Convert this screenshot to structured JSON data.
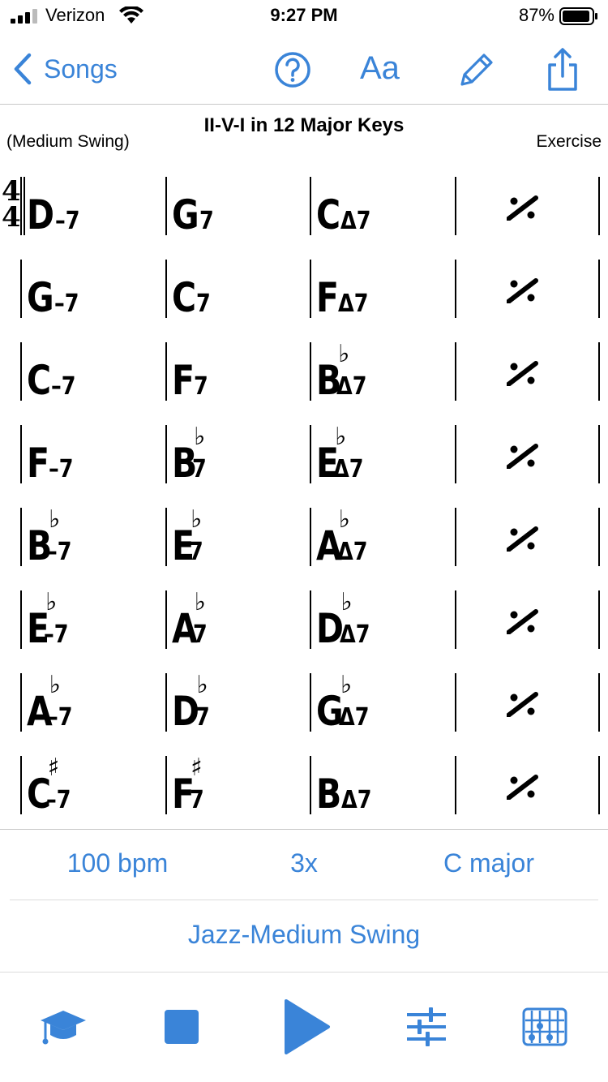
{
  "status_bar": {
    "carrier": "Verizon",
    "time": "9:27 PM",
    "battery_percent": "87%"
  },
  "nav": {
    "back_label": "Songs",
    "font_button_label": "Aa",
    "icons": [
      "help-icon",
      "font-size-icon",
      "edit-pencil-icon",
      "share-icon"
    ]
  },
  "song": {
    "title": "II-V-I in 12 Major Keys",
    "style": "(Medium Swing)",
    "composer": "Exercise",
    "time_signature": {
      "top": "4",
      "bottom": "4"
    }
  },
  "chart": {
    "rows": [
      [
        {
          "root": "D",
          "acc": "",
          "qual": "–7"
        },
        {
          "root": "G",
          "acc": "",
          "qual": "7"
        },
        {
          "root": "C",
          "acc": "",
          "qual": "Δ7"
        },
        {
          "repeat": true
        }
      ],
      [
        {
          "root": "G",
          "acc": "",
          "qual": "–7"
        },
        {
          "root": "C",
          "acc": "",
          "qual": "7"
        },
        {
          "root": "F",
          "acc": "",
          "qual": "Δ7"
        },
        {
          "repeat": true
        }
      ],
      [
        {
          "root": "C",
          "acc": "",
          "qual": "–7"
        },
        {
          "root": "F",
          "acc": "",
          "qual": "7"
        },
        {
          "root": "B",
          "acc": "♭",
          "qual": "Δ7"
        },
        {
          "repeat": true
        }
      ],
      [
        {
          "root": "F",
          "acc": "",
          "qual": "–7"
        },
        {
          "root": "B",
          "acc": "♭",
          "qual": "7"
        },
        {
          "root": "E",
          "acc": "♭",
          "qual": "Δ7"
        },
        {
          "repeat": true
        }
      ],
      [
        {
          "root": "B",
          "acc": "♭",
          "qual": "–7"
        },
        {
          "root": "E",
          "acc": "♭",
          "qual": "7"
        },
        {
          "root": "A",
          "acc": "♭",
          "qual": "Δ7"
        },
        {
          "repeat": true
        }
      ],
      [
        {
          "root": "E",
          "acc": "♭",
          "qual": "–7"
        },
        {
          "root": "A",
          "acc": "♭",
          "qual": "7"
        },
        {
          "root": "D",
          "acc": "♭",
          "qual": "Δ7"
        },
        {
          "repeat": true
        }
      ],
      [
        {
          "root": "A",
          "acc": "♭",
          "qual": "–7"
        },
        {
          "root": "D",
          "acc": "♭",
          "qual": "7"
        },
        {
          "root": "G",
          "acc": "♭",
          "qual": "Δ7"
        },
        {
          "repeat": true
        }
      ],
      [
        {
          "root": "C",
          "acc": "♯",
          "qual": "–7"
        },
        {
          "root": "F",
          "acc": "♯",
          "qual": "7"
        },
        {
          "root": "B",
          "acc": "",
          "qual": "Δ7"
        },
        {
          "repeat": true
        }
      ]
    ]
  },
  "settings": {
    "tempo": "100 bpm",
    "repeats": "3x",
    "key": "C major",
    "style": "Jazz-Medium Swing"
  },
  "toolbar": {
    "icons": [
      "graduation-cap-icon",
      "stop-icon",
      "play-icon",
      "mixer-sliders-icon",
      "chord-grid-icon"
    ]
  },
  "colors": {
    "accent": "#3a84d8",
    "divider": "#c8c8c8"
  }
}
